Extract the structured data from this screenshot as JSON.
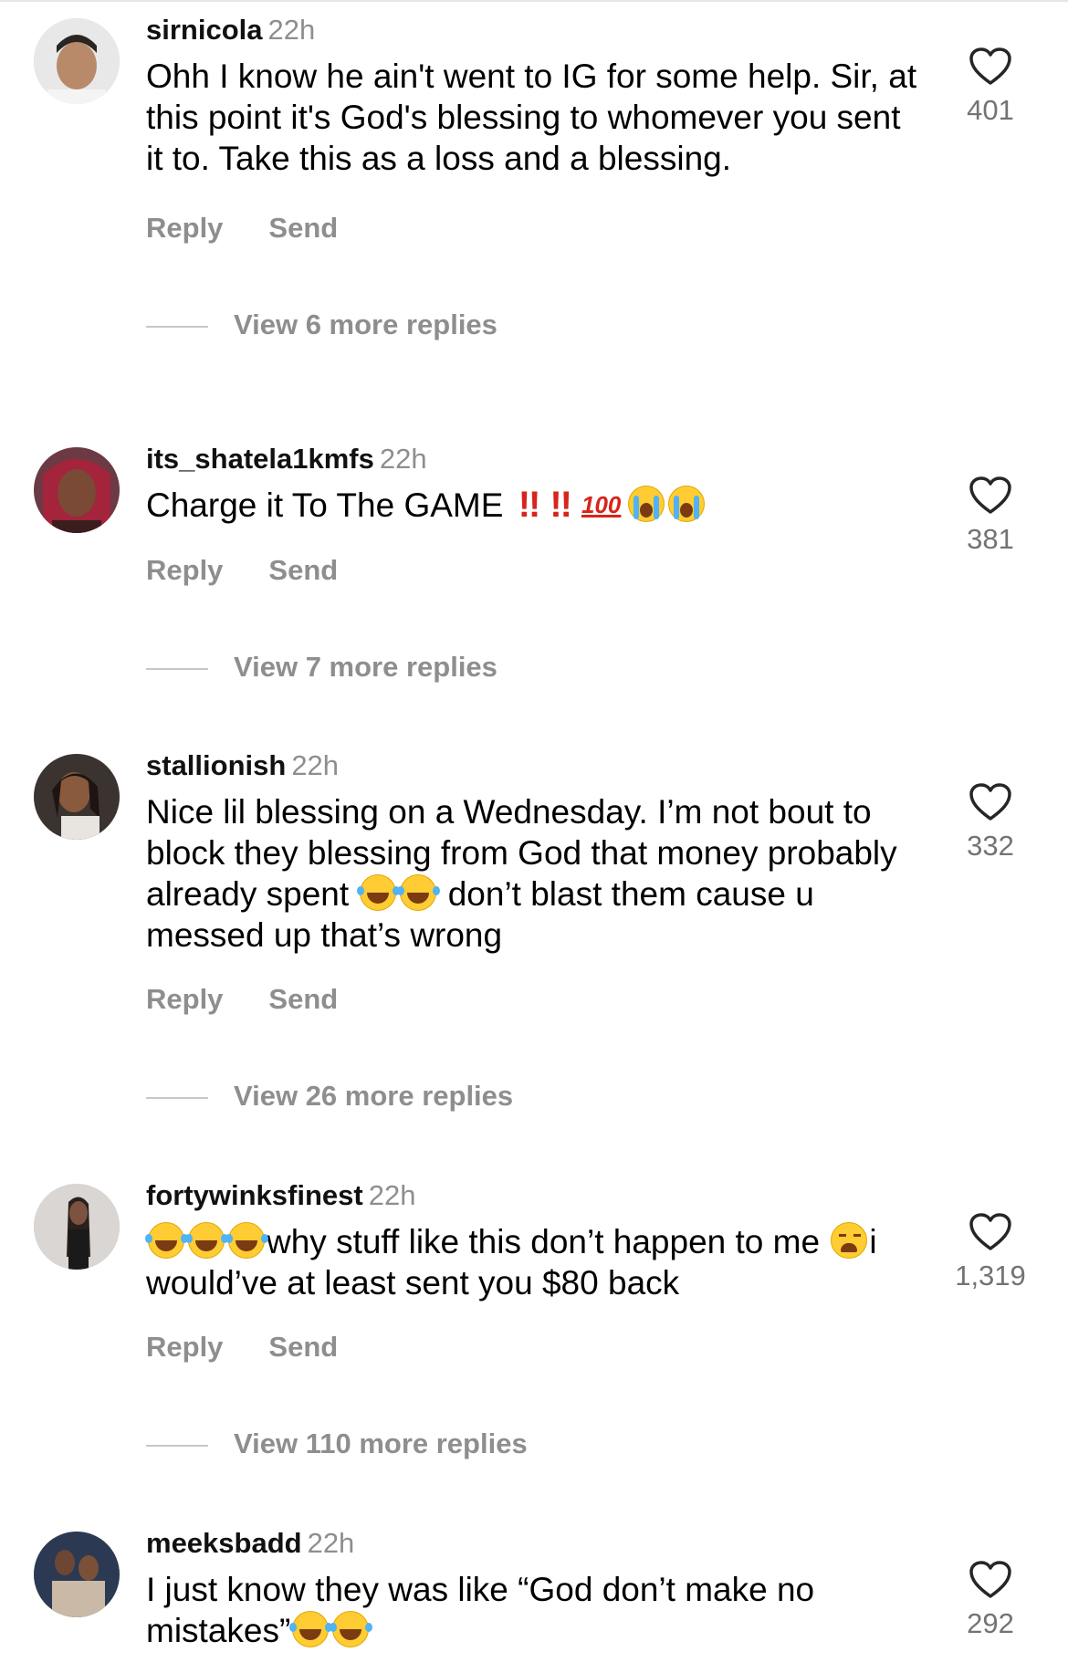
{
  "comments": [
    {
      "username": "sirnicola",
      "time": "22h",
      "text": "Ohh I know he ain't went to IG for some help. Sir, at this point it's God's blessing to whomever you sent it to. Take this as a loss and a blessing.",
      "likes": "401",
      "reply_label": "Reply",
      "send_label": "Send",
      "view_more": "View 6 more replies"
    },
    {
      "username": "its_shatela1kmfs",
      "time": "22h",
      "text": "Charge it To The GAME",
      "emojis": [
        "double-exclamation-emoji",
        "double-exclamation-emoji",
        "hundred-points-emoji",
        "crying-face-emoji",
        "crying-face-emoji"
      ],
      "likes": "381",
      "reply_label": "Reply",
      "send_label": "Send",
      "view_more": "View 7 more replies"
    },
    {
      "username": "stallionish",
      "time": "22h",
      "text_part1": "Nice lil blessing on a Wednesday. I’m not bout to block they blessing from God that money probably already spent",
      "text_part2": "don’t blast them cause u messed up that’s wrong",
      "emojis": [
        "tears-of-joy-emoji",
        "tears-of-joy-emoji"
      ],
      "likes": "332",
      "reply_label": "Reply",
      "send_label": "Send",
      "view_more": "View 26 more replies"
    },
    {
      "username": "fortywinksfinest",
      "time": "22h",
      "text_part1": "why stuff like this don’t happen to me",
      "text_part2": "i would’ve at least sent you $80 back",
      "emojis": [
        "tears-of-joy-emoji",
        "tears-of-joy-emoji",
        "tears-of-joy-emoji",
        "weary-face-emoji"
      ],
      "likes": "1,319",
      "reply_label": "Reply",
      "send_label": "Send",
      "view_more": "View 110 more replies"
    },
    {
      "username": "meeksbadd",
      "time": "22h",
      "text": "I just know they was like “God don’t make no mistakes”",
      "emojis": [
        "tears-of-joy-emoji",
        "tears-of-joy-emoji"
      ],
      "likes": "292"
    }
  ],
  "glyphs": {
    "double_exclamation": "!!",
    "hundred": "100"
  },
  "colors": {
    "secondary_text": "#8e8e8e",
    "like_count": "#737373"
  }
}
